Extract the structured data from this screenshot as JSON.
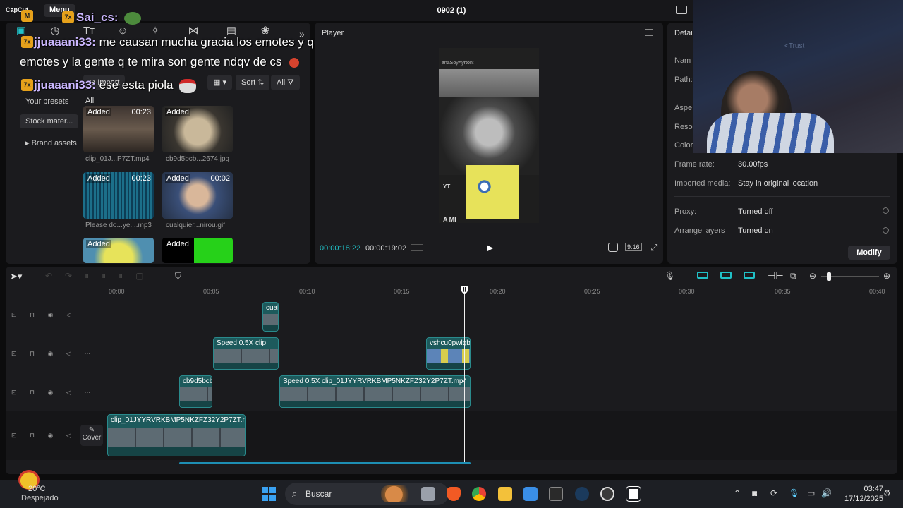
{
  "titlebar": {
    "app_name": "CapCut",
    "menu_label": "Menu",
    "document_title": "0902 (1)"
  },
  "chat_overlay": {
    "messages": [
      {
        "user": "Sai_cs:",
        "text": ""
      },
      {
        "user": "jjuaaani33:",
        "text": "me causan mucha gracia los emotes y que uses"
      },
      {
        "user": "",
        "text": "emotes y la gente q te mira son gente ndqv de cs"
      },
      {
        "user": "jjuaaani33:",
        "text": "ese esta piola"
      }
    ]
  },
  "media": {
    "import_label": "Import",
    "sort_label": "Sort",
    "all_filter": "All",
    "all_heading": "All",
    "sidebar": [
      "Your presets",
      "Stock mater...",
      "Brand assets"
    ],
    "items": [
      {
        "status": "Added",
        "duration": "00:23",
        "name": "clip_01J...P7ZT.mp4"
      },
      {
        "status": "Added",
        "duration": "",
        "name": "cb9d5bcb...2674.jpg"
      },
      {
        "status": "Added",
        "duration": "00:23",
        "name": "Please do...ye....mp3"
      },
      {
        "status": "Added",
        "duration": "00:02",
        "name": "cualquier...nirou.gif"
      },
      {
        "status": "Added",
        "duration": "",
        "name": ""
      },
      {
        "status": "Added",
        "duration": "",
        "name": ""
      }
    ]
  },
  "player": {
    "label": "Player",
    "current_time": "00:00:18:22",
    "total_time": "00:00:19:02",
    "ratio": "9:16",
    "overlay_texts": [
      "anaSoyAyrton:",
      "YT",
      "A MI"
    ]
  },
  "details": {
    "title": "Detai",
    "rows": [
      {
        "label": "Nam",
        "value": ""
      },
      {
        "label": "Path:",
        "value": ""
      },
      {
        "label": "Aspe",
        "value": ""
      },
      {
        "label": "Resol",
        "value": ""
      },
      {
        "label": "Color",
        "value": ""
      },
      {
        "label": "Frame rate:",
        "value": "30.00fps"
      },
      {
        "label": "Imported media:",
        "value": "Stay in original location"
      },
      {
        "label": "Proxy:",
        "value": "Turned off"
      },
      {
        "label": "Arrange layers",
        "value": "Turned on"
      }
    ],
    "modify_label": "Modify",
    "webcam_text": "<Trust"
  },
  "timeline": {
    "ruler": [
      "00:00",
      "00:05",
      "00:10",
      "00:15",
      "00:20",
      "00:25",
      "00:30",
      "00:35",
      "00:40"
    ],
    "cover_label": "Cover",
    "clips": [
      {
        "title": "cual"
      },
      {
        "title": "Speed 0.5X  clip"
      },
      {
        "title": "vshcu0pwlqb"
      },
      {
        "title": "cb9d5bcb"
      },
      {
        "title": "Speed 0.5X  clip_01JYYRVRKBMP5NKZFZ32Y2P7ZT.mp4"
      },
      {
        "title": "clip_01JYYRVRKBMP5NKZFZ32Y2P7ZT.mp4"
      }
    ]
  },
  "taskbar": {
    "weather_temp": "20°C",
    "weather_desc": "Despejado",
    "search_placeholder": "Buscar",
    "time": "03:47",
    "date": "17/12/2025"
  },
  "colors": {
    "accent": "#20c1c7",
    "clip_teal": "#1d5a5c",
    "panel_bg": "#1b1b1e"
  }
}
